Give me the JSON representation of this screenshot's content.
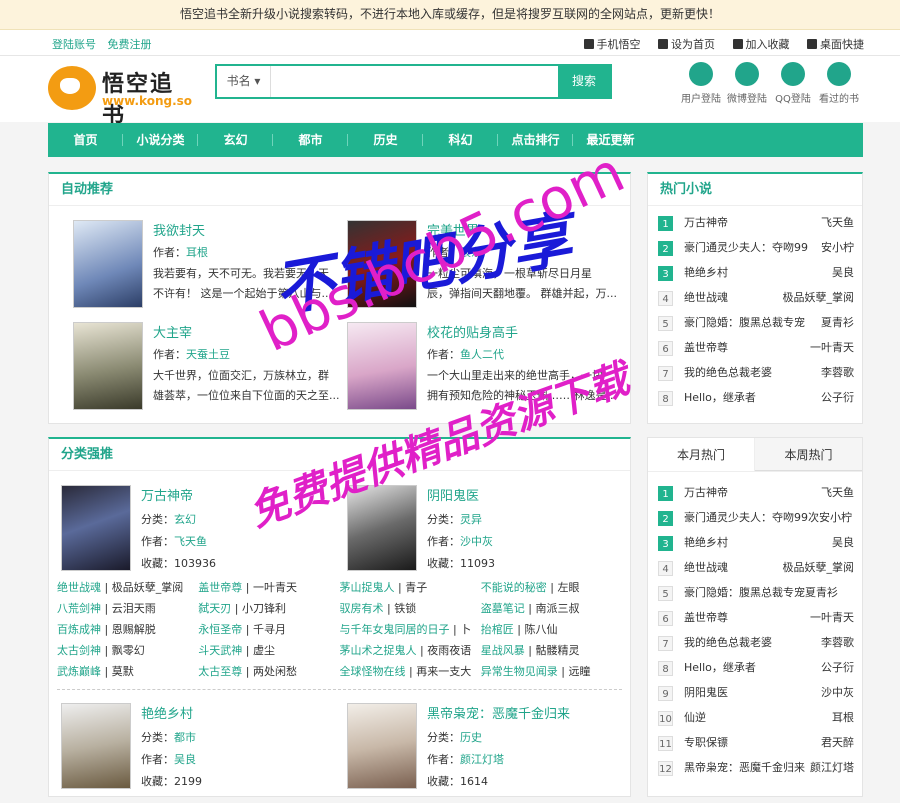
{
  "notice": "悟空追书全新升级小说搜索转码，不进行本地入库或缓存，但是将搜罗互联网的全网站点，更新更快！",
  "topbar": {
    "login": "登陆账号",
    "register": "免费注册",
    "mobile": "手机悟空",
    "home": "设为首页",
    "fav": "加入收藏",
    "desktop": "桌面快捷"
  },
  "logo": {
    "title": "悟空追书",
    "url": "www.kong.so"
  },
  "search": {
    "select": "书名",
    "button": "搜索",
    "value": ""
  },
  "quick": [
    "用户登陆",
    "微博登陆",
    "QQ登陆",
    "看过的书"
  ],
  "nav": [
    "首页",
    "小说分类",
    "玄幻",
    "都市",
    "历史",
    "科幻",
    "点击排行",
    "最近更新"
  ],
  "auto": {
    "title": "自动推荐",
    "author_label": "作者：",
    "items": [
      {
        "title": "我欲封天",
        "author": "耳根",
        "desc": "我若要有，天不可无。我若要无，天 不许有！ 这是一个起始于第八山与..."
      },
      {
        "title": "完美世界",
        "author": "辰东",
        "desc": "一粒尘可填海，一根草斩尽日月星 辰，弹指间天翻地覆。 群雄并起，万..."
      },
      {
        "title": "大主宰",
        "author": "天蚕土豆",
        "desc": "大千世界，位面交汇，万族林立，群 雄荟萃，一位位来自下位面的天之至..."
      },
      {
        "title": "校花的贴身高手",
        "author": "鱼人二代",
        "desc": "一个大山里走出来的绝世高手，一块 拥有预知危险的神秘玉佩…… 林逸是..."
      }
    ]
  },
  "classes": {
    "title": "分类强推",
    "category_label": "分类：",
    "author_label": "作者：",
    "fav_label": "收藏：",
    "featured": [
      {
        "title": "万古神帝",
        "category": "玄幻",
        "author": "飞天鱼",
        "fav": "103936"
      },
      {
        "title": "阴阳鬼医",
        "category": "灵异",
        "author": "沙中灰",
        "fav": "11093"
      },
      {
        "title": "艳绝乡村",
        "category": "都市",
        "author": "吴良",
        "fav": "2199"
      },
      {
        "title": "黑帝枭宠：恶魔千金归来",
        "category": "历史",
        "author": "颜江灯塔",
        "fav": "1614"
      }
    ],
    "links": [
      [
        [
          "绝世战魂",
          "极品妖孽_掌阅"
        ],
        [
          "盖世帝尊",
          "一叶青天"
        ],
        [
          "茅山捉鬼人",
          "青子"
        ],
        [
          "不能说的秘密",
          "左眼"
        ]
      ],
      [
        [
          "八荒剑神",
          "云泪天雨"
        ],
        [
          "弑天刃",
          "小刀锋利"
        ],
        [
          "驭房有术",
          "铁锁"
        ],
        [
          "盗墓笔记",
          "南派三叔"
        ]
      ],
      [
        [
          "百炼成神",
          "恩赐解脱"
        ],
        [
          "永恒圣帝",
          "千寻月"
        ],
        [
          "与千年女鬼同居的日子",
          "卜"
        ],
        [
          "抬棺匠",
          "陈八仙"
        ]
      ],
      [
        [
          "太古剑神",
          "飘零幻"
        ],
        [
          "斗天武神",
          "虚尘"
        ],
        [
          "茅山术之捉鬼人",
          "夜雨夜语"
        ],
        [
          "星战风暴",
          "骷髅精灵"
        ]
      ],
      [
        [
          "武炼巅峰",
          "莫默"
        ],
        [
          "太古至尊",
          "两处闲愁"
        ],
        [
          "全球怪物在线",
          "再来一支大"
        ],
        [
          "异常生物见闻录",
          "远瞳"
        ]
      ]
    ]
  },
  "hot": {
    "title": "热门小说",
    "items": [
      {
        "n": "1",
        "name": "万古神帝",
        "author": "飞天鱼"
      },
      {
        "n": "2",
        "name": "豪门通灵少夫人：夺吻99",
        "author": "安小柠"
      },
      {
        "n": "3",
        "name": "艳绝乡村",
        "author": "吴良"
      },
      {
        "n": "4",
        "name": "绝世战魂",
        "author": "极品妖孽_掌阅"
      },
      {
        "n": "5",
        "name": "豪门隐婚：腹黑总裁专宠",
        "author": "夏青衫"
      },
      {
        "n": "6",
        "name": "盖世帝尊",
        "author": "一叶青天"
      },
      {
        "n": "7",
        "name": "我的绝色总裁老婆",
        "author": "李蓉歌"
      },
      {
        "n": "8",
        "name": "Hello，继承者",
        "author": "公子衍"
      }
    ]
  },
  "monthly": {
    "tab_month": "本月热门",
    "tab_week": "本周热门",
    "items": [
      {
        "n": "1",
        "name": "万古神帝",
        "author": "飞天鱼"
      },
      {
        "n": "2",
        "name": "豪门通灵少夫人：夺吻99次安小柠",
        "author": ""
      },
      {
        "n": "3",
        "name": "艳绝乡村",
        "author": "吴良"
      },
      {
        "n": "4",
        "name": "绝世战魂",
        "author": "极品妖孽_掌阅"
      },
      {
        "n": "5",
        "name": "豪门隐婚：腹黑总裁专宠夏青衫",
        "author": ""
      },
      {
        "n": "6",
        "name": "盖世帝尊",
        "author": "一叶青天"
      },
      {
        "n": "7",
        "name": "我的绝色总裁老婆",
        "author": "李蓉歌"
      },
      {
        "n": "8",
        "name": "Hello，继承者",
        "author": "公子衍"
      },
      {
        "n": "9",
        "name": "阴阳鬼医",
        "author": "沙中灰"
      },
      {
        "n": "10",
        "name": "仙逆",
        "author": "耳根"
      },
      {
        "n": "11",
        "name": "专职保镖",
        "author": "君天醉"
      },
      {
        "n": "12",
        "name": "黑帝枭宠：恶魔千金归来",
        "author": "颜江灯塔"
      }
    ]
  },
  "watermarks": {
    "line1": "不错吧分享",
    "line2": "bbs.bcb5.com",
    "line3": "免费提供精品资源下载"
  },
  "colors": {
    "accent": "#21b48f",
    "link": "#21a58b",
    "watermark_blue": "#1a1ad8",
    "watermark_pink": "#e020c8"
  }
}
